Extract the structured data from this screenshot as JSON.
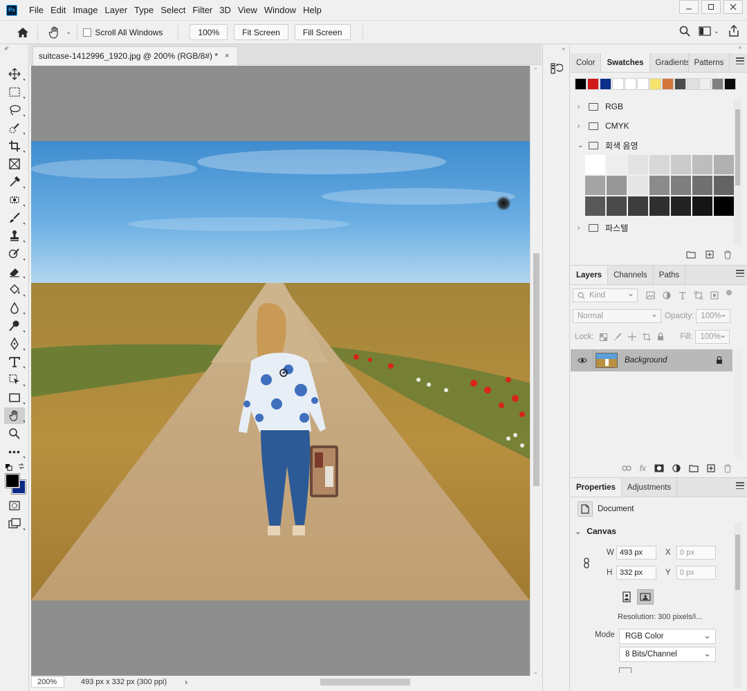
{
  "app": {
    "logo_text": "Ps",
    "menu": [
      "File",
      "Edit",
      "Image",
      "Layer",
      "Type",
      "Select",
      "Filter",
      "3D",
      "View",
      "Window",
      "Help"
    ]
  },
  "options_bar": {
    "scroll_all_windows": "Scroll All Windows",
    "zoom_100": "100%",
    "fit_screen": "Fit Screen",
    "fill_screen": "Fill Screen"
  },
  "document": {
    "tab_title": "suitcase-1412996_1920.jpg @ 200% (RGB/8#) *",
    "close": "×"
  },
  "status": {
    "zoom": "200%",
    "info": "493 px x 332 px (300 ppi)",
    "arrow": "›"
  },
  "swatches_panel": {
    "tabs": [
      "Color",
      "Swatches",
      "Gradients",
      "Patterns"
    ],
    "active_tab": "Swatches",
    "recent_colors": [
      "#000000",
      "#d21a1a",
      "#0a2e8c",
      "#ffffff",
      "#ffffff",
      "#ffffff",
      "#f5e46a",
      "#d2763a",
      "#4a4a4a",
      "#e0e0e0",
      "#eeeeee",
      "#808080",
      "#0a0a0a"
    ],
    "folders": [
      {
        "name": "RGB",
        "expanded": false
      },
      {
        "name": "CMYK",
        "expanded": false
      },
      {
        "name": "회색 음영",
        "expanded": true
      },
      {
        "name": "파스텔",
        "expanded": false
      }
    ],
    "grayscale": [
      "#ffffff",
      "#eeeeee",
      "#e3e3e3",
      "#d8d8d8",
      "#cbcbcb",
      "#bdbdbd",
      "#b0b0b0",
      "#a4a4a4",
      "#979797",
      "#e6e6e6",
      "#8b8b8b",
      "#7e7e7e",
      "#707070",
      "#636363",
      "#585858",
      "#4a4a4a",
      "#3d3d3d",
      "#2f2f2f",
      "#222222",
      "#151515",
      "#000000"
    ]
  },
  "layers_panel": {
    "tabs": [
      "Layers",
      "Channels",
      "Paths"
    ],
    "active_tab": "Layers",
    "kind_placeholder": "Kind",
    "blend_mode": "Normal",
    "opacity_label": "Opacity:",
    "opacity_value": "100%",
    "lock_label": "Lock:",
    "fill_label": "Fill:",
    "fill_value": "100%",
    "layers": [
      {
        "name": "Background",
        "visible": true,
        "locked": true
      }
    ]
  },
  "properties_panel": {
    "tabs": [
      "Properties",
      "Adjustments"
    ],
    "active_tab": "Properties",
    "doc_label": "Document",
    "section": "Canvas",
    "w_label": "W",
    "w_value": "493 px",
    "h_label": "H",
    "h_value": "332 px",
    "x_label": "X",
    "x_value": "0 px",
    "y_label": "Y",
    "y_value": "0 px",
    "resolution": "Resolution: 300 pixels/i...",
    "mode_label": "Mode",
    "mode_value": "RGB Color",
    "bits_value": "8 Bits/Channel"
  },
  "colors": {
    "foreground": "#000000",
    "background": "#0a2a8a"
  }
}
